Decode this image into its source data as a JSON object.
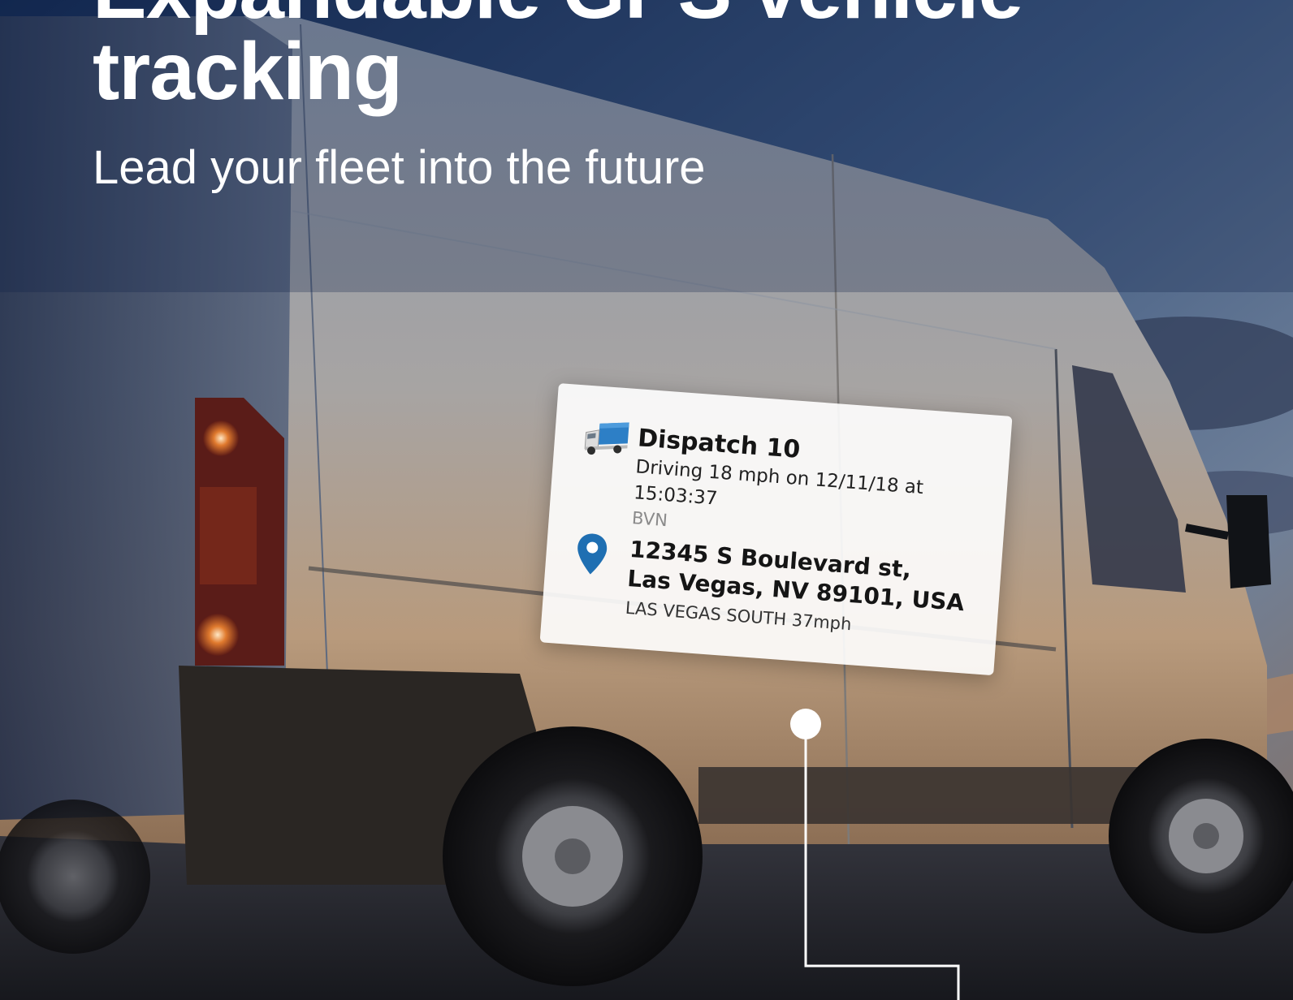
{
  "hero": {
    "title_line1": "Expandable GPS vehicle",
    "title_line2": "tracking",
    "subtitle": "Lead your fleet into the future"
  },
  "card": {
    "vehicle_icon": "truck-icon",
    "vehicle_name": "Dispatch 10",
    "status": "Driving 18 mph on 12/11/18 at 15:03:37",
    "group": "BVN",
    "location_icon": "map-pin-icon",
    "address_line1": "12345 S Boulevard st,",
    "address_line2": "Las Vegas, NV 89101, USA",
    "road_speed": "LAS VEGAS SOUTH 37mph"
  },
  "colors": {
    "pin": "#1f6fb2",
    "truck_cargo": "#2d7fc6",
    "text_primary": "#151515",
    "text_muted": "#8a8a8a"
  }
}
